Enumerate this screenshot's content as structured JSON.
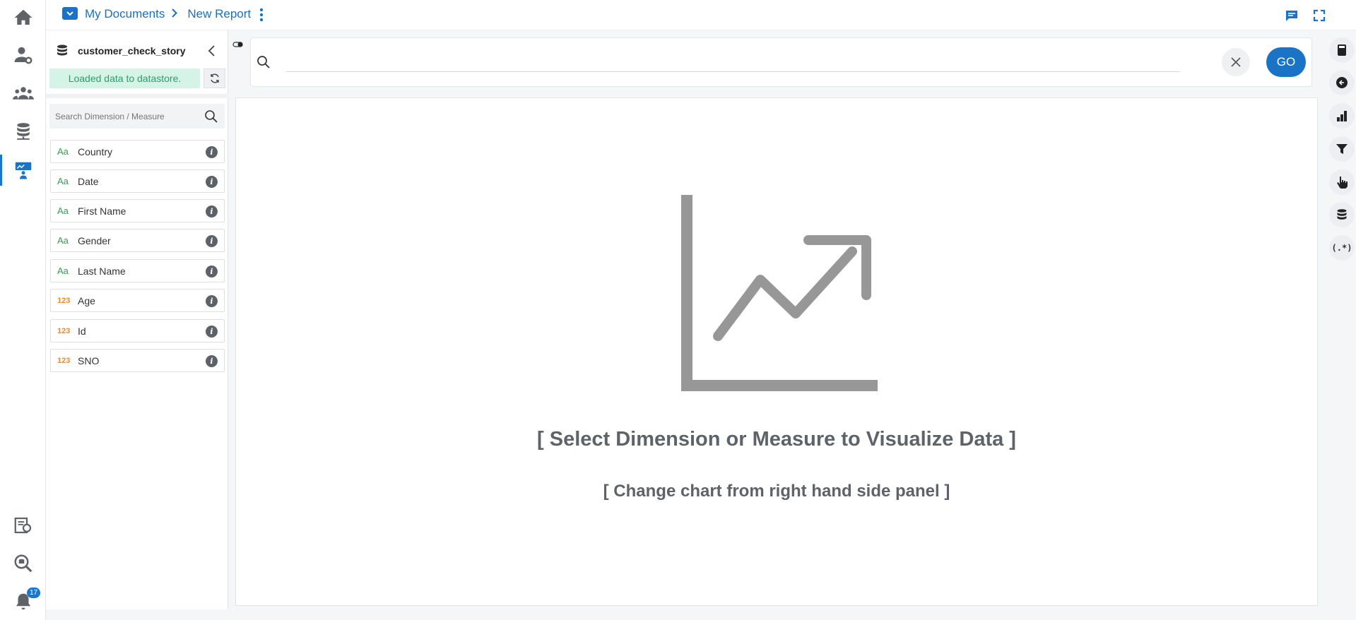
{
  "breadcrumb": {
    "root": "My Documents",
    "current": "New Report"
  },
  "rail": {
    "notification_count": "17"
  },
  "datastore": {
    "name": "customer_check_story",
    "status": "Loaded data to datastore.",
    "search_placeholder": "Search Dimension / Measure"
  },
  "fields": [
    {
      "type_label": "Aa",
      "kind": "dimension",
      "name": "Country"
    },
    {
      "type_label": "Aa",
      "kind": "dimension",
      "name": "Date"
    },
    {
      "type_label": "Aa",
      "kind": "dimension",
      "name": "First Name"
    },
    {
      "type_label": "Aa",
      "kind": "dimension",
      "name": "Gender"
    },
    {
      "type_label": "Aa",
      "kind": "dimension",
      "name": "Last Name"
    },
    {
      "type_label": "123",
      "kind": "measure",
      "name": "Age"
    },
    {
      "type_label": "123",
      "kind": "measure",
      "name": "Id"
    },
    {
      "type_label": "123",
      "kind": "measure",
      "name": "SNO"
    }
  ],
  "query": {
    "value": "",
    "go_label": "GO"
  },
  "canvas": {
    "message_primary": "[ Select Dimension or Measure to Visualize Data ]",
    "message_secondary": "[ Change chart from right hand side panel ]"
  },
  "right_rail": {
    "regex_label": "(.*)"
  },
  "colors": {
    "accent": "#1a73c4",
    "dimension": "#3a9a57",
    "measure": "#ef8a2c",
    "status_bg": "#d5f3e6"
  }
}
